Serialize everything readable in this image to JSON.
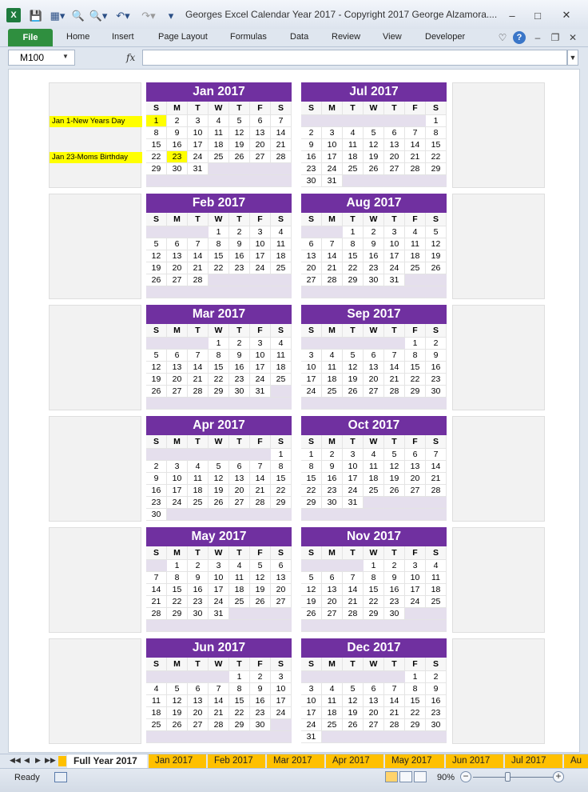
{
  "window": {
    "title": "Georges Excel Calendar Year 2017  -  Copyright 2017 George Alzamora....",
    "app_icon": "X"
  },
  "ribbon": {
    "file_label": "File",
    "tabs": [
      "Home",
      "Insert",
      "Page Layout",
      "Formulas",
      "Data",
      "Review",
      "View",
      "Developer"
    ]
  },
  "formula_bar": {
    "name_box": "M100",
    "fx": "fx",
    "formula": ""
  },
  "notes": [
    {
      "text": "Jan 1-New Years Day",
      "row": 1
    },
    {
      "text": "Jan 23-Moms Birthday",
      "row": 4
    }
  ],
  "calendar": {
    "weekdays": [
      "S",
      "M",
      "T",
      "W",
      "T",
      "F",
      "S"
    ],
    "highlight_color": "#ffff00",
    "header_color": "#7030a0",
    "highlight_days": {
      "Jan 2017": [
        1,
        23
      ]
    },
    "months": [
      {
        "title": "Jan 2017",
        "offset": 0,
        "days": 31
      },
      {
        "title": "Feb 2017",
        "offset": 3,
        "days": 28
      },
      {
        "title": "Mar 2017",
        "offset": 3,
        "days": 31
      },
      {
        "title": "Apr 2017",
        "offset": 6,
        "days": 30
      },
      {
        "title": "May 2017",
        "offset": 1,
        "days": 31
      },
      {
        "title": "Jun 2017",
        "offset": 4,
        "days": 30
      },
      {
        "title": "Jul 2017",
        "offset": 6,
        "days": 31
      },
      {
        "title": "Aug 2017",
        "offset": 2,
        "days": 31
      },
      {
        "title": "Sep 2017",
        "offset": 5,
        "days": 30
      },
      {
        "title": "Oct 2017",
        "offset": 0,
        "days": 31
      },
      {
        "title": "Nov 2017",
        "offset": 3,
        "days": 30
      },
      {
        "title": "Dec 2017",
        "offset": 5,
        "days": 31
      }
    ]
  },
  "sheet_tabs": [
    "Full Year 2017",
    "Jan 2017",
    "Feb 2017",
    "Mar 2017",
    "Apr 2017",
    "May 2017",
    "Jun 2017",
    "Jul 2017",
    "Au"
  ],
  "status": {
    "ready": "Ready",
    "zoom": "90%"
  }
}
